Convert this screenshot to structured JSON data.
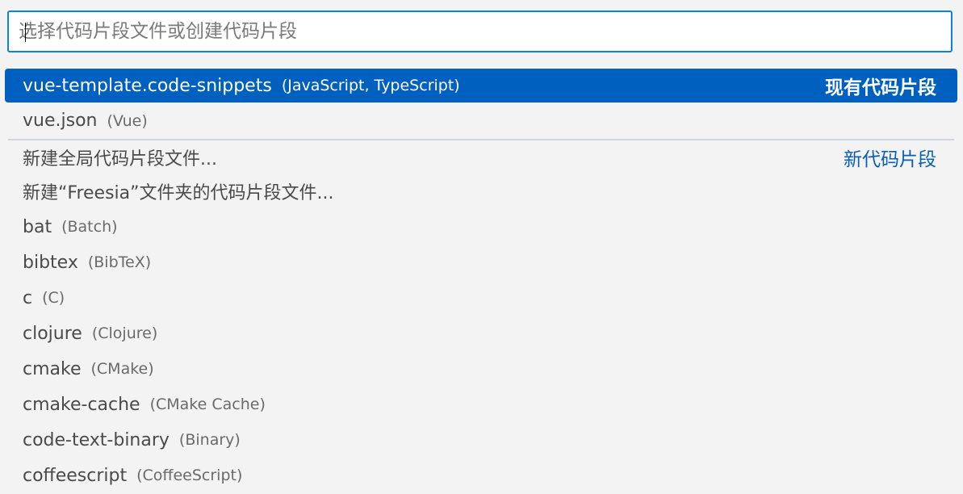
{
  "search": {
    "placeholder": "选择代码片段文件或创建代码片段",
    "value": ""
  },
  "items": [
    {
      "label": "vue-template.code-snippets",
      "desc": "(JavaScript, TypeScript)",
      "group": "现有代码片段"
    },
    {
      "label": "vue.json",
      "desc": "(Vue)",
      "group": ""
    },
    {
      "label": "新建全局代码片段文件...",
      "desc": "",
      "group": "新代码片段"
    },
    {
      "label": "新建“Freesia”文件夹的代码片段文件...",
      "desc": "",
      "group": ""
    },
    {
      "label": "bat",
      "desc": "(Batch)",
      "group": ""
    },
    {
      "label": "bibtex",
      "desc": "(BibTeX)",
      "group": ""
    },
    {
      "label": "c",
      "desc": "(C)",
      "group": ""
    },
    {
      "label": "clojure",
      "desc": "(Clojure)",
      "group": ""
    },
    {
      "label": "cmake",
      "desc": "(CMake)",
      "group": ""
    },
    {
      "label": "cmake-cache",
      "desc": "(CMake Cache)",
      "group": ""
    },
    {
      "label": "code-text-binary",
      "desc": "(Binary)",
      "group": ""
    },
    {
      "label": "coffeescript",
      "desc": "(CoffeeScript)",
      "group": ""
    }
  ],
  "colors": {
    "selected_bg": "#0060c0",
    "focus_border": "#0a84d6",
    "group_label": "#0a5fb4",
    "background": "#f3f3f3"
  }
}
